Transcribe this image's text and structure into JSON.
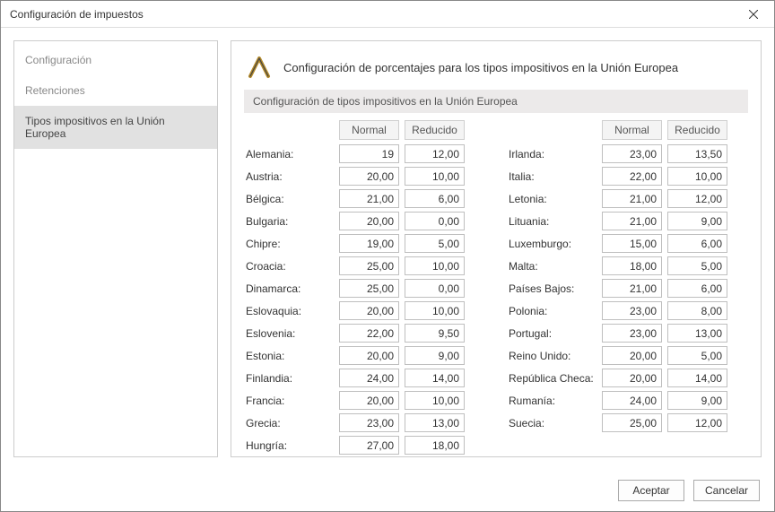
{
  "window": {
    "title": "Configuración de impuestos"
  },
  "sidebar": {
    "items": [
      {
        "label": "Configuración"
      },
      {
        "label": "Retenciones"
      },
      {
        "label": "Tipos impositivos en la Unión Europea"
      }
    ],
    "active_index": 2
  },
  "main": {
    "header": "Configuración de porcentajes para los tipos impositivos en la Unión Europea",
    "section": "Configuración de tipos impositivos en la Unión Europea",
    "col_normal": "Normal",
    "col_reducido": "Reducido",
    "left": [
      {
        "country": "Alemania:",
        "normal": "19",
        "reduced": "12,00"
      },
      {
        "country": "Austria:",
        "normal": "20,00",
        "reduced": "10,00"
      },
      {
        "country": "Bélgica:",
        "normal": "21,00",
        "reduced": "6,00"
      },
      {
        "country": "Bulgaria:",
        "normal": "20,00",
        "reduced": "0,00"
      },
      {
        "country": "Chipre:",
        "normal": "19,00",
        "reduced": "5,00"
      },
      {
        "country": "Croacia:",
        "normal": "25,00",
        "reduced": "10,00"
      },
      {
        "country": "Dinamarca:",
        "normal": "25,00",
        "reduced": "0,00"
      },
      {
        "country": "Eslovaquia:",
        "normal": "20,00",
        "reduced": "10,00"
      },
      {
        "country": "Eslovenia:",
        "normal": "22,00",
        "reduced": "9,50"
      },
      {
        "country": "Estonia:",
        "normal": "20,00",
        "reduced": "9,00"
      },
      {
        "country": "Finlandia:",
        "normal": "24,00",
        "reduced": "14,00"
      },
      {
        "country": "Francia:",
        "normal": "20,00",
        "reduced": "10,00"
      },
      {
        "country": "Grecia:",
        "normal": "23,00",
        "reduced": "13,00"
      },
      {
        "country": "Hungría:",
        "normal": "27,00",
        "reduced": "18,00"
      }
    ],
    "right": [
      {
        "country": "Irlanda:",
        "normal": "23,00",
        "reduced": "13,50"
      },
      {
        "country": "Italia:",
        "normal": "22,00",
        "reduced": "10,00"
      },
      {
        "country": "Letonia:",
        "normal": "21,00",
        "reduced": "12,00"
      },
      {
        "country": "Lituania:",
        "normal": "21,00",
        "reduced": "9,00"
      },
      {
        "country": "Luxemburgo:",
        "normal": "15,00",
        "reduced": "6,00"
      },
      {
        "country": "Malta:",
        "normal": "18,00",
        "reduced": "5,00"
      },
      {
        "country": "Países Bajos:",
        "normal": "21,00",
        "reduced": "6,00"
      },
      {
        "country": "Polonia:",
        "normal": "23,00",
        "reduced": "8,00"
      },
      {
        "country": "Portugal:",
        "normal": "23,00",
        "reduced": "13,00"
      },
      {
        "country": "Reino Unido:",
        "normal": "20,00",
        "reduced": "5,00"
      },
      {
        "country": "República Checa:",
        "normal": "20,00",
        "reduced": "14,00"
      },
      {
        "country": "Rumanía:",
        "normal": "24,00",
        "reduced": "9,00"
      },
      {
        "country": "Suecia:",
        "normal": "25,00",
        "reduced": "12,00"
      }
    ]
  },
  "footer": {
    "accept": "Aceptar",
    "cancel": "Cancelar"
  }
}
